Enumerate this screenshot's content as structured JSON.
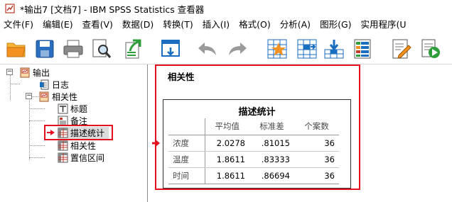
{
  "window": {
    "title": "*输出7 [文档7] - IBM SPSS Statistics 查看器"
  },
  "menubar": {
    "items": [
      "文件(F)",
      "编辑(E)",
      "查看(V)",
      "数据(D)",
      "转换(T)",
      "插入(I)",
      "格式(O)",
      "分析(A)",
      "图形(G)",
      "实用程序(U"
    ]
  },
  "toolbar": {
    "buttons": [
      "open-icon",
      "save-icon",
      "print-icon",
      "print-preview-icon",
      "export-icon",
      "recall-dialog-icon",
      "undo-icon",
      "redo-icon",
      "goto-data-icon",
      "goto-case-icon",
      "goto-variable-icon",
      "variables-icon",
      "designate-window-icon",
      "run-script-icon"
    ]
  },
  "tree": {
    "root": "输出",
    "log": "日志",
    "group": "相关性",
    "items": {
      "title": "标题",
      "notes": "备注",
      "descriptives": "描述统计",
      "correlations": "相关性",
      "ci": "置信区间"
    }
  },
  "content": {
    "section_title": "相关性",
    "table": {
      "title": "描述统计",
      "headers": [
        "平均值",
        "标准差",
        "个案数"
      ],
      "rows": [
        {
          "label": "浓度",
          "mean": "2.0278",
          "sd": ".81015",
          "n": "36"
        },
        {
          "label": "温度",
          "mean": "1.8611",
          "sd": ".83333",
          "n": "36"
        },
        {
          "label": "时间",
          "mean": "1.8611",
          "sd": ".86694",
          "n": "36"
        }
      ]
    }
  },
  "colors": {
    "highlight_red": "#e3101f",
    "selection_gray": "#dcdcdc",
    "tool_blue": "#1a6ec0",
    "tool_orange": "#f39221"
  }
}
